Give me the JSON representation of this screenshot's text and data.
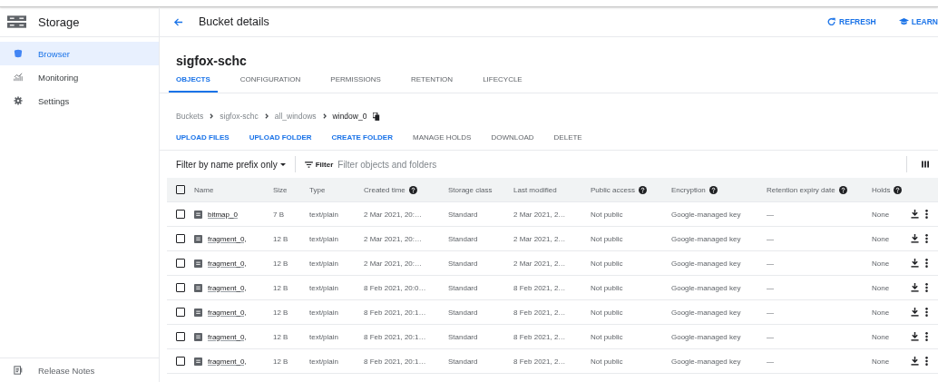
{
  "sidebar": {
    "title": "Storage",
    "items": [
      {
        "label": "Browser",
        "kind": "bucket",
        "selected": true
      },
      {
        "label": "Monitoring",
        "kind": "chart",
        "selected": false
      },
      {
        "label": "Settings",
        "kind": "gear",
        "selected": false
      }
    ],
    "footer": {
      "label": "Release Notes"
    }
  },
  "header": {
    "title": "Bucket details",
    "actions": [
      {
        "label": "REFRESH",
        "kind": "refresh"
      },
      {
        "label": "LEARN",
        "kind": "learn"
      }
    ]
  },
  "bucket_name": "sigfox-schc",
  "tabs": [
    {
      "label": "OBJECTS",
      "selected": true
    },
    {
      "label": "CONFIGURATION",
      "selected": false
    },
    {
      "label": "PERMISSIONS",
      "selected": false
    },
    {
      "label": "RETENTION",
      "selected": false
    },
    {
      "label": "LIFECYCLE",
      "selected": false
    }
  ],
  "breadcrumbs": [
    "Buckets",
    "sigfox-schc",
    "all_windows",
    "window_0"
  ],
  "toolbar": [
    {
      "label": "UPLOAD FILES",
      "disabled": false
    },
    {
      "label": "UPLOAD FOLDER",
      "disabled": false
    },
    {
      "label": "CREATE FOLDER",
      "disabled": false
    },
    {
      "label": "MANAGE HOLDS",
      "disabled": true
    },
    {
      "label": "DOWNLOAD",
      "disabled": true
    },
    {
      "label": "DELETE",
      "disabled": true
    }
  ],
  "filter": {
    "mode": "Filter by name prefix only",
    "label": "Filter",
    "placeholder": "Filter objects and folders"
  },
  "table": {
    "all_checked": false,
    "columns": [
      {
        "label": "Name",
        "help": false
      },
      {
        "label": "Size",
        "help": false
      },
      {
        "label": "Type",
        "help": false
      },
      {
        "label": "Created time",
        "help": true
      },
      {
        "label": "Storage class",
        "help": false
      },
      {
        "label": "Last modified",
        "help": false
      },
      {
        "label": "Public access",
        "help": true
      },
      {
        "label": "Encryption",
        "help": true
      },
      {
        "label": "Retention expiry date",
        "help": true
      },
      {
        "label": "Holds",
        "help": true
      }
    ],
    "rows": [
      {
        "checked": false,
        "cells": [
          "bitmap_0",
          "7 B",
          "text/plain",
          "2 Mar 2021, 20:…",
          "Standard",
          "2 Mar 2021, 2…",
          "Not public",
          "Google-managed key",
          "—",
          "None"
        ]
      },
      {
        "checked": false,
        "cells": [
          "fragment_0,",
          "12 B",
          "text/plain",
          "2 Mar 2021, 20:…",
          "Standard",
          "2 Mar 2021, 2…",
          "Not public",
          "Google-managed key",
          "—",
          "None"
        ]
      },
      {
        "checked": false,
        "cells": [
          "fragment_0,",
          "12 B",
          "text/plain",
          "2 Mar 2021, 20:…",
          "Standard",
          "2 Mar 2021, 2…",
          "Not public",
          "Google-managed key",
          "—",
          "None"
        ]
      },
      {
        "checked": false,
        "cells": [
          "fragment_0,",
          "12 B",
          "text/plain",
          "8 Feb 2021, 20:0…",
          "Standard",
          "8 Feb 2021, 2…",
          "Not public",
          "Google-managed key",
          "—",
          "None"
        ]
      },
      {
        "checked": false,
        "cells": [
          "fragment_0,",
          "12 B",
          "text/plain",
          "8 Feb 2021, 20:1…",
          "Standard",
          "8 Feb 2021, 2…",
          "Not public",
          "Google-managed key",
          "—",
          "None"
        ]
      },
      {
        "checked": false,
        "cells": [
          "fragment_0,",
          "12 B",
          "text/plain",
          "8 Feb 2021, 20:1…",
          "Standard",
          "8 Feb 2021, 2…",
          "Not public",
          "Google-managed key",
          "—",
          "None"
        ]
      },
      {
        "checked": false,
        "cells": [
          "fragment_0,",
          "12 B",
          "text/plain",
          "8 Feb 2021, 20:1…",
          "Standard",
          "8 Feb 2021, 2…",
          "Not public",
          "Google-managed key",
          "—",
          "None"
        ]
      }
    ]
  }
}
